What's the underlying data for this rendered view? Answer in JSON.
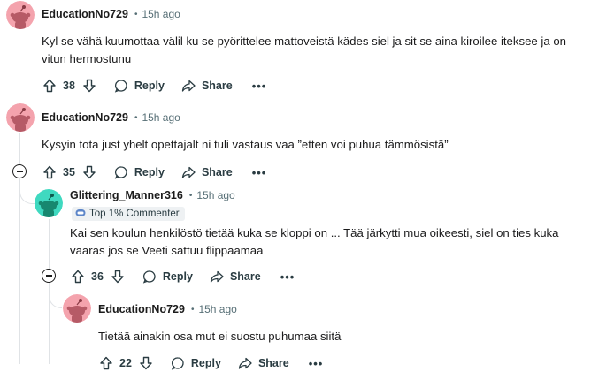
{
  "comments": [
    {
      "username": "EducationNo729",
      "time": "15h ago",
      "text": "Kyl se vähä kuumottaa välil ku se pyörittelee mattoveistä kädes siel ja sit se aina kiroilee iteksee ja on vitun hermostunu",
      "votes": "38",
      "reply_label": "Reply",
      "share_label": "Share",
      "more_label": "•••",
      "avatar_color": "#f4a3ad"
    },
    {
      "username": "EducationNo729",
      "time": "15h ago",
      "text": "Kysyin tota just yhelt opettajalt ni tuli vastaus vaa ”etten voi puhua tämmösistä”",
      "votes": "35",
      "reply_label": "Reply",
      "share_label": "Share",
      "more_label": "•••",
      "avatar_color": "#f4a3ad"
    },
    {
      "username": "Glittering_Manner316",
      "time": "15h ago",
      "badge": "Top 1% Commenter",
      "text": "Kai sen koulun henkilöstö tietää kuka se kloppi on ... Tää järkytti mua oikeesti, siel on ties kuka vaaras jos se Veeti sattuu flippaamaa",
      "votes": "36",
      "reply_label": "Reply",
      "share_label": "Share",
      "more_label": "•••",
      "avatar_color": "#3fd9c0"
    },
    {
      "username": "EducationNo729",
      "time": "15h ago",
      "text": "Tietää ainakin osa mut ei suostu puhumaa siitä",
      "votes": "22",
      "reply_label": "Reply",
      "share_label": "Share",
      "more_label": "•••",
      "avatar_color": "#f4a3ad"
    }
  ],
  "separator": "•",
  "icons": {
    "upvote": "arrow-up-icon",
    "downvote": "arrow-down-icon",
    "reply": "speech-bubble-icon",
    "share": "share-arrow-icon",
    "collapse": "minus-circle-icon",
    "badge": "commenter-badge-icon"
  }
}
